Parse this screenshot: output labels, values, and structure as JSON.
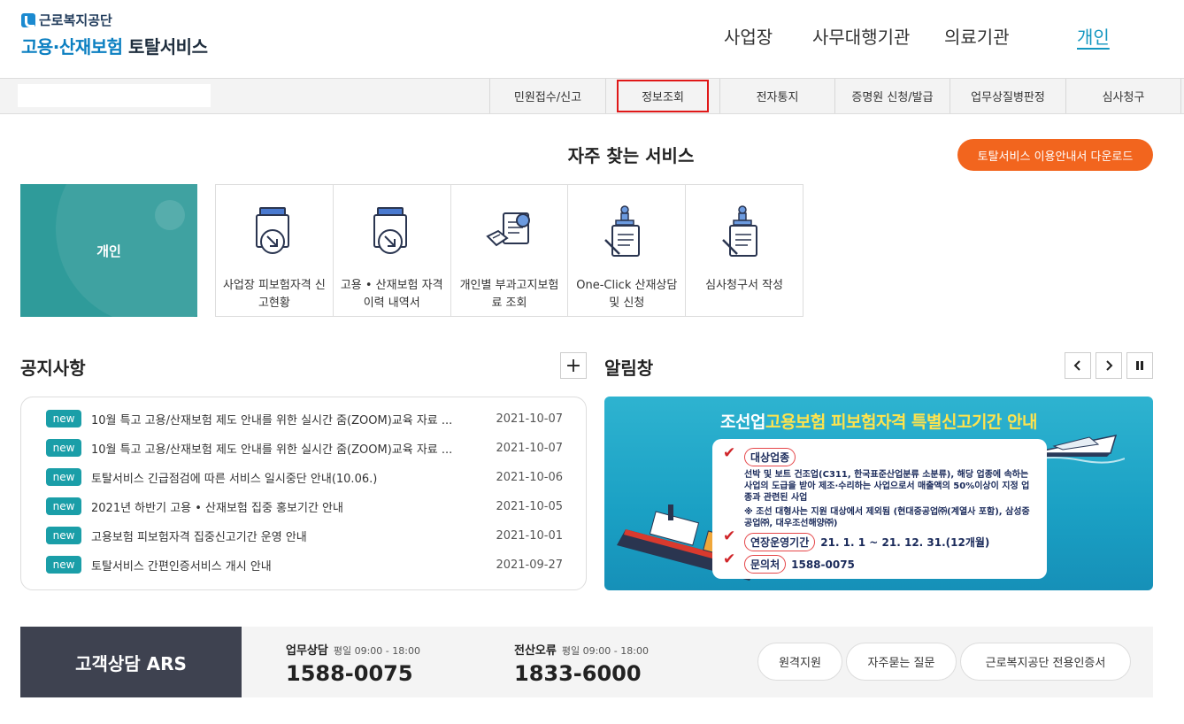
{
  "header": {
    "org_name": "근로복지공단",
    "brand_a": "고용·산재보험",
    "brand_b": "토탈서비스",
    "nav": [
      "사업장",
      "사무대행기관",
      "의료기관",
      "개인"
    ],
    "nav_active": "개인"
  },
  "menu": {
    "search_value": "",
    "items": [
      "민원접수/신고",
      "정보조회",
      "전자통지",
      "증명원 신청/발급",
      "업무상질병판정",
      "심사청구"
    ],
    "highlighted": "정보조회"
  },
  "frequent": {
    "title": "자주 찾는 서비스",
    "download_button": "토탈서비스 이용안내서 다운로드",
    "card_label": "개인",
    "services": [
      {
        "label": "사업장 피보험자격 신고현황",
        "icon": "document-download-icon"
      },
      {
        "label": "고용 • 산재보험 자격 이력 내역서",
        "icon": "document-download-icon"
      },
      {
        "label": "개인별 부과고지보험료 조회",
        "icon": "document-search-icon"
      },
      {
        "label": "One-Click 산재상담 및 신청",
        "icon": "stamp-document-icon"
      },
      {
        "label": "심사청구서 작성",
        "icon": "stamp-document-icon"
      }
    ]
  },
  "notices": {
    "title": "공지사항",
    "more_icon": "plus-icon",
    "items": [
      {
        "badge": "new",
        "title": "10월 특고 고용/산재보험 제도 안내를 위한 실시간 줌(ZOOM)교육 자료 ...",
        "date": "2021-10-07"
      },
      {
        "badge": "new",
        "title": "10월 특고 고용/산재보험 제도 안내를 위한 실시간 줌(ZOOM)교육 자료 ...",
        "date": "2021-10-07"
      },
      {
        "badge": "new",
        "title": "토탈서비스 긴급점검에 따른 서비스 일시중단 안내(10.06.)",
        "date": "2021-10-06"
      },
      {
        "badge": "new",
        "title": "2021년 하반기 고용 • 산재보험 집중 홍보기간 안내",
        "date": "2021-10-05"
      },
      {
        "badge": "new",
        "title": "고용보험 피보험자격 집중신고기간 운영 안내",
        "date": "2021-10-01"
      },
      {
        "badge": "new",
        "title": "토탈서비스 간편인증서비스 개시 안내",
        "date": "2021-09-27"
      }
    ]
  },
  "alarm": {
    "title": "알림창",
    "controls": [
      "chevron-left-icon",
      "chevron-right-icon",
      "pause-icon"
    ],
    "banner": {
      "title_a": "조선업",
      "title_b": "고용보험 피보험자격 특별신고기간 안내",
      "h1": "대상업종",
      "text1": "선박 및 보트 건조업(C311, 한국표준산업분류 소분류), 해당 업종에 속하는 사업의 도급을 받아 제조·수리하는 사업으로서 매출액의 50%이상이 지정 업종과 관련된 사업",
      "text2": "※ 조선 대형사는 지원 대상에서 제외됨 (현대중공업㈜(계열사 포함), 삼성중공업㈜, 대우조선해양㈜)",
      "h2": "연장운영기간",
      "v2": "21. 1. 1 ~ 21. 12. 31.(12개월)",
      "h3": "문의처",
      "v3": "1588-0075"
    }
  },
  "customer": {
    "title": "고객상담 ARS",
    "work": {
      "label": "업무상담",
      "hours": "평일 09:00 - 18:00",
      "number": "1588-0075"
    },
    "error": {
      "label": "전산오류",
      "hours": "평일 09:00 - 18:00",
      "number": "1833-6000"
    },
    "buttons": [
      "원격지원",
      "자주묻는 질문",
      "근로복지공단 전용인증서"
    ]
  },
  "colors": {
    "accent_teal": "#2f9b9a",
    "nav_active": "#1296c0",
    "download_orange": "#f2651e",
    "badge_teal": "#1a9ea8",
    "highlight_red": "#e01818"
  }
}
